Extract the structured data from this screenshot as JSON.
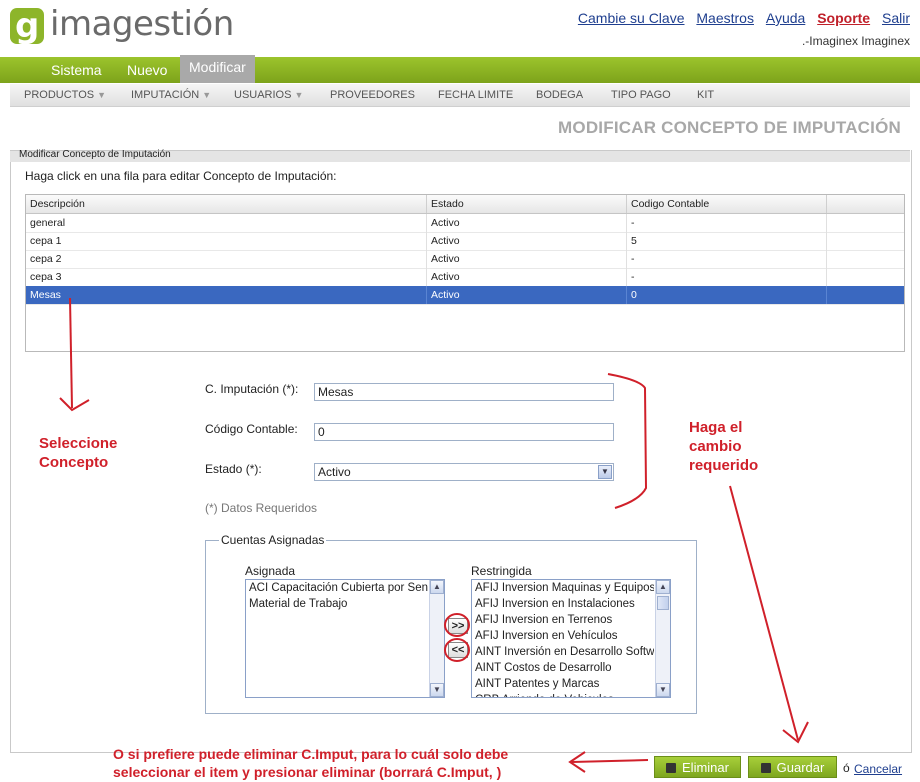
{
  "header": {
    "logo_letter": "g",
    "logo_text": "imagestión",
    "links": [
      "Cambie su Clave",
      "Maestros",
      "Ayuda",
      "Soporte",
      "Salir"
    ],
    "user": ".-Imaginex Imaginex"
  },
  "main_nav": [
    "Sistema",
    "Nuevo",
    "Modificar"
  ],
  "sub_nav": [
    {
      "label": "PRODUCTOS",
      "arrow": "▼"
    },
    {
      "label": "IMPUTACIÓN",
      "arrow": "▼"
    },
    {
      "label": "USUARIOS",
      "arrow": "▼"
    },
    {
      "label": "PROVEEDORES",
      "arrow": ""
    },
    {
      "label": "FECHA LIMITE",
      "arrow": ""
    },
    {
      "label": "BODEGA",
      "arrow": ""
    },
    {
      "label": "TIPO PAGO",
      "arrow": ""
    },
    {
      "label": "KIT",
      "arrow": ""
    }
  ],
  "page_title": "MODIFICAR CONCEPTO DE IMPUTACIÓN",
  "panel": {
    "title": "Modificar Concepto de Imputación",
    "hint": "Haga click en una fila para editar Concepto de Imputación:"
  },
  "grid": {
    "columns": [
      "Descripción",
      "Estado",
      "Codigo Contable"
    ],
    "rows": [
      [
        "general",
        "Activo",
        "-"
      ],
      [
        "cepa 1",
        "Activo",
        "5"
      ],
      [
        "cepa 2",
        "Activo",
        "-"
      ],
      [
        "cepa 3",
        "Activo",
        "-"
      ],
      [
        "Mesas",
        "Activo",
        "0"
      ]
    ],
    "selected_row": 4
  },
  "form": {
    "imputacion_label": "C. Imputación (*):",
    "imputacion_value": "Mesas",
    "codigo_label": "Código Contable:",
    "codigo_value": "0",
    "estado_label": "Estado (*):",
    "estado_value": "Activo",
    "required_note": "(*) Datos Requeridos"
  },
  "cuentas": {
    "legend": "Cuentas Asignadas",
    "asignada_label": "Asignada",
    "restringida_label": "Restringida",
    "asignada": [
      "ACI Capacitación Cubierta por Sence",
      "Material de Trabajo"
    ],
    "restringida": [
      "AFIJ Inversion Maquinas y Equipos",
      "AFIJ Inversion en Instalaciones",
      "AFIJ Inversion en Terrenos",
      "AFIJ Inversion en Vehículos",
      "AINT Inversión en Desarrollo Software",
      "AINT Costos de Desarrollo",
      "AINT Patentes y Marcas",
      "CRB Arriendo de Vehiculos"
    ],
    "add_label": ">>",
    "remove_label": "<<"
  },
  "annotations": {
    "seleccione": [
      "Seleccione",
      "Concepto"
    ],
    "haga": [
      "Haga el",
      "cambio",
      "requerido"
    ],
    "eliminar_hint": [
      "O si prefiere puede eliminar C.Imput, para lo cuál solo debe",
      "seleccionar el item y presionar eliminar (borrará  C.Imput,  )"
    ]
  },
  "buttons": {
    "eliminar": "Eliminar",
    "guardar": "Guardar",
    "or": "ó",
    "cancelar": "Cancelar"
  },
  "colors": {
    "brand_green": "#8db52a",
    "selection": "#3a68c0",
    "annotation_red": "#d0202a"
  }
}
